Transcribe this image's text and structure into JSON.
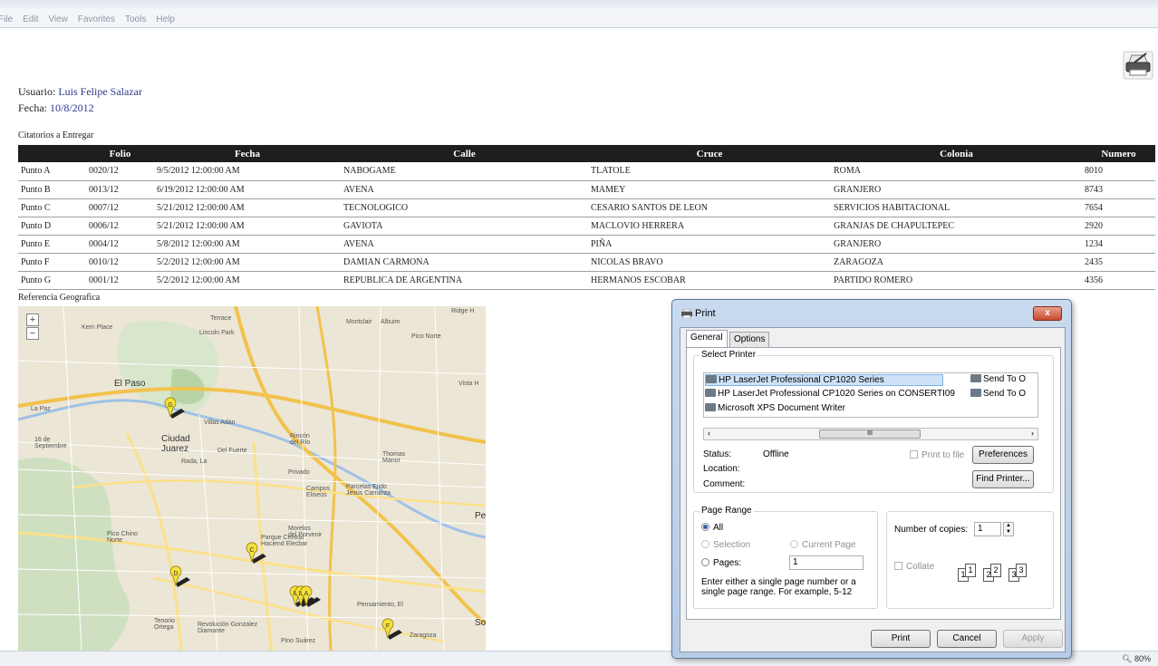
{
  "menu": [
    "File",
    "Edit",
    "View",
    "Favorites",
    "Tools",
    "Help"
  ],
  "user": {
    "usuario_label": "Usuario:",
    "usuario": "Luis Felipe Salazar",
    "fecha_label": "Fecha:",
    "fecha": "10/8/2012"
  },
  "section_title": "Citatorios a Entregar",
  "table": {
    "headers": [
      "",
      "Folio",
      "Fecha",
      "Calle",
      "Cruce",
      "Colonia",
      "Numero"
    ],
    "rows": [
      [
        "Punto A",
        "0020/12",
        "9/5/2012 12:00:00 AM",
        "NABOGAME",
        "TLATOLE",
        "ROMA",
        "8010"
      ],
      [
        "Punto B",
        "0013/12",
        "6/19/2012 12:00:00 AM",
        "AVENA",
        "MAMEY",
        "GRANJERO",
        "8743"
      ],
      [
        "Punto C",
        "0007/12",
        "5/21/2012 12:00:00 AM",
        "TECNOLOGICO",
        "CESARIO SANTOS DE LEON",
        "SERVICIOS HABITACIONAL",
        "7654"
      ],
      [
        "Punto D",
        "0006/12",
        "5/21/2012 12:00:00 AM",
        "GAVIOTA",
        "MACLOVIO HERRERA",
        "GRANJAS DE CHAPULTEPEC",
        "2920"
      ],
      [
        "Punto E",
        "0004/12",
        "5/8/2012 12:00:00 AM",
        "AVENA",
        "PIÑA",
        "GRANJERO",
        "1234"
      ],
      [
        "Punto F",
        "0010/12",
        "5/2/2012 12:00:00 AM",
        "DAMIAN CARMONA",
        "NICOLAS BRAVO",
        "ZARAGOZA",
        "2435"
      ],
      [
        "Punto G",
        "0001/12",
        "5/2/2012 12:00:00 AM",
        "REPUBLICA DE ARGENTINA",
        "HERMANOS ESCOBAR",
        "PARTIDO ROMERO",
        "4356"
      ]
    ]
  },
  "geo_title": "Referencia Geografica",
  "map": {
    "zoom_in": "+",
    "zoom_out": "−",
    "labels": {
      "el_paso": "El Paso",
      "ciudad_juarez": "Ciudad\nJuarez",
      "la_paz": "La Paz",
      "kern_place": "Kern Place",
      "lincoln_park": "Lincoln Park",
      "montclair": "Montclair",
      "albuim": "Albuim",
      "pico_norte": "Pico Norte",
      "ridge": "Ridge H",
      "vista": "Vista H",
      "villas_adan": "Villas Adán",
      "del_fuerte": "Del Fuerte",
      "rincon": "Rincón\ndel Río",
      "thomas": "Thomas\nManor",
      "rada": "Rada, La",
      "privado": "Privado",
      "campos_eliseos": "Campos\nEliseos",
      "parcelas": "Parcelas Ejido\nJesús Carranza",
      "sept": "16 de\nSeptiembre",
      "pico_chino": "Pico Chino\nNorte",
      "morelos": "Morelos\ndel Porvenir",
      "parque": "Parque Central\nHaciend Elecbar",
      "pensamiento": "Pensamiento, El",
      "zaragoza": "Zaragoza",
      "tenorio": "Tenorio\nOrtega",
      "revolucion": "Revolución Gonzalez\nDiamante",
      "pino": "Pino Suárez",
      "terrace": "Terrace",
      "soc": "Soc",
      "pe": "Pe"
    },
    "markers": [
      "G",
      "C",
      "D",
      "E",
      "B",
      "A",
      "F"
    ]
  },
  "status": {
    "zoom_level": "80%"
  },
  "dialog": {
    "title": "Print",
    "close": "x",
    "tabs": [
      "General",
      "Options"
    ],
    "select_printer_title": "Select Printer",
    "printers": [
      "HP LaserJet Professional CP1020 Series",
      "HP LaserJet Professional CP1020 Series on CONSERTI09",
      "Microsoft XPS Document Writer",
      "Send To O",
      "Send To O"
    ],
    "scroll_left": "‹",
    "scroll_right": "›",
    "scroll_thumb": "III",
    "status_label": "Status:",
    "status_value": "Offline",
    "location_label": "Location:",
    "comment_label": "Comment:",
    "print_to_file": "Print to file",
    "preferences": "Preferences",
    "find_printer": "Find Printer...",
    "page_range_title": "Page Range",
    "all": "All",
    "selection": "Selection",
    "current_page": "Current Page",
    "pages": "Pages:",
    "pages_value": "1",
    "hint": "Enter either a single page number or a single page range.  For example, 5-12",
    "copies_label": "Number of copies:",
    "copies_value": "1",
    "collate": "Collate",
    "collate_pages": [
      "1",
      "1",
      "2",
      "2",
      "3",
      "3"
    ],
    "print_btn": "Print",
    "cancel_btn": "Cancel",
    "apply_btn": "Apply"
  }
}
